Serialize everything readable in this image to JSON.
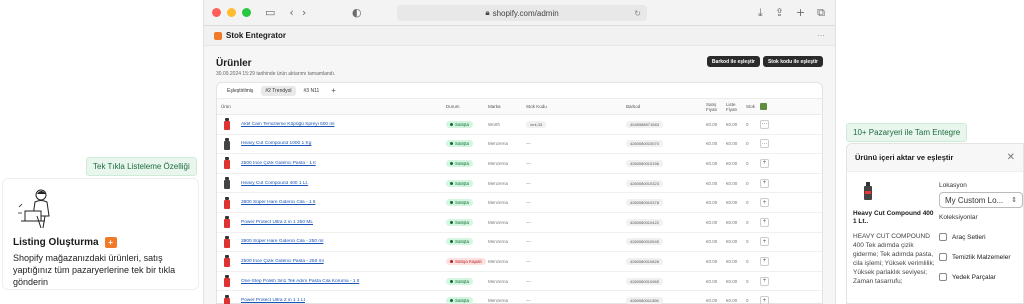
{
  "left_panel": {
    "tag": "Tek Tıkla Listeleme Özelliği",
    "card_title": "Listing Oluşturma",
    "card_description": "Shopify mağazanızdaki ürünleri, satış yaptığınız tüm pazaryerlerine tek bir tıkla gönderin"
  },
  "browser": {
    "url": "shopify.com/admin",
    "app_name": "Stok Entegrator",
    "page_title": "Ürünler",
    "page_subtitle": "30.09.2024 15:29 tarihinde ürün aktarımı tamamlandı.",
    "buttons": {
      "barcode_match": "Barkod ile eşleştir",
      "sku_match": "Stok kodu ile eşleştir"
    },
    "tabs": [
      "Eşleştirilmiş",
      "#2 Trendyol",
      "#3 N11",
      "+"
    ],
    "columns": [
      "Ürün",
      "Durum",
      "Marka",
      "Stok Kodu",
      "Barkod",
      "Satış Fiyatı",
      "Liste Fiyatı",
      "Stok"
    ],
    "rows": [
      {
        "name": "Aktif Cam Temizleme Köpüğü Spreyi 500 ml",
        "status": "Satışta",
        "closed": false,
        "brand": "Würth",
        "sku": "xrnl-33",
        "barcode": "4045988971583",
        "price": "€0.00",
        "list": "€0.00",
        "stock": "0",
        "action": "···",
        "thumb": "red"
      },
      {
        "name": "Heavy Cut Compound 1000 1 Kg",
        "status": "Satışta",
        "closed": false,
        "brand": "Menzerna",
        "sku": "—",
        "barcode": "4260080010070",
        "price": "€0.00",
        "list": "€0.00",
        "stock": "0",
        "action": "···",
        "thumb": "dark"
      },
      {
        "name": "2500 İnce Çizik Giderici Pasta - 1 lt",
        "status": "Satışta",
        "closed": false,
        "brand": "Menzerna",
        "sku": "—",
        "barcode": "4260080010156",
        "price": "€0.00",
        "list": "€0.00",
        "stock": "0",
        "action": "+",
        "thumb": "red"
      },
      {
        "name": "Heavy Cut Compound 400 1 Lt.",
        "status": "Satışta",
        "closed": false,
        "brand": "Menzerna",
        "sku": "—",
        "barcode": "4260080010323",
        "price": "€0.00",
        "list": "€0.00",
        "stock": "0",
        "action": "+",
        "thumb": "dark"
      },
      {
        "name": "3800 Süper Hare Giderici Cila - 1 lt",
        "status": "Satışta",
        "closed": false,
        "brand": "Menzerna",
        "sku": "—",
        "barcode": "4260080010378",
        "price": "€0.00",
        "list": "€0.00",
        "stock": "0",
        "action": "+",
        "thumb": "red"
      },
      {
        "name": "Power Protect Ultra 2 in 1 250 ML",
        "status": "Satışta",
        "closed": false,
        "brand": "Menzerna",
        "sku": "—",
        "barcode": "4260080010422",
        "price": "€0.00",
        "list": "€0.00",
        "stock": "0",
        "action": "+",
        "thumb": "red"
      },
      {
        "name": "3800 Süper Hare Giderici Cila - 250 ml",
        "status": "Satışta",
        "closed": false,
        "brand": "Menzerna",
        "sku": "—",
        "barcode": "4260080010545",
        "price": "€0.00",
        "list": "€0.00",
        "stock": "0",
        "action": "+",
        "thumb": "red"
      },
      {
        "name": "2500 İnce Çizik Giderici Pasta - 250 ml",
        "status": "Satışa Kapalı",
        "closed": true,
        "brand": "Menzerna",
        "sku": "—",
        "barcode": "4260080010828",
        "price": "€0.00",
        "list": "€0.00",
        "stock": "0",
        "action": "+",
        "thumb": "red"
      },
      {
        "name": "One-Step Polish 3in1 Tek Adım Pasta Cila Koruma - 1 lt",
        "status": "Satışta",
        "closed": false,
        "brand": "Menzerna",
        "sku": "—",
        "barcode": "4260080010965",
        "price": "€0.00",
        "list": "€0.00",
        "stock": "0",
        "action": "+",
        "thumb": "red"
      },
      {
        "name": "Power Protect Ultra 2 in 1 1 Lt",
        "status": "Satışta",
        "closed": false,
        "brand": "Menzerna",
        "sku": "—",
        "barcode": "4260080011306",
        "price": "€0.00",
        "list": "€0.00",
        "stock": "0",
        "action": "+",
        "thumb": "red"
      }
    ]
  },
  "right_panel": {
    "tag": "10+ Pazaryeri ile Tam Entegre",
    "modal_title": "Ürünü içeri aktar ve eşleştir",
    "product_title": "Heavy Cut Compound 400 1 Lt..",
    "product_desc": "HEAVY CUT COMPOUND 400 Tek adımda çizik giderme; Tek adımda pasta, cila işlemi; Yüksek verimlilik; Yüksek parlaklık seviyesi; Zaman tasarrufu;",
    "location_label": "Lokasyon",
    "location_value": "My Custom Lo...",
    "collections_label": "Koleksiyonlar",
    "collections": [
      "Araç Setleri",
      "Temizlik Malzemeler",
      "Yedek Parçalar"
    ]
  },
  "colors": {
    "traffic_red": "#ff5f57",
    "traffic_yellow": "#febc2e",
    "traffic_green": "#28c840",
    "brand_orange": "#f07a2a"
  }
}
